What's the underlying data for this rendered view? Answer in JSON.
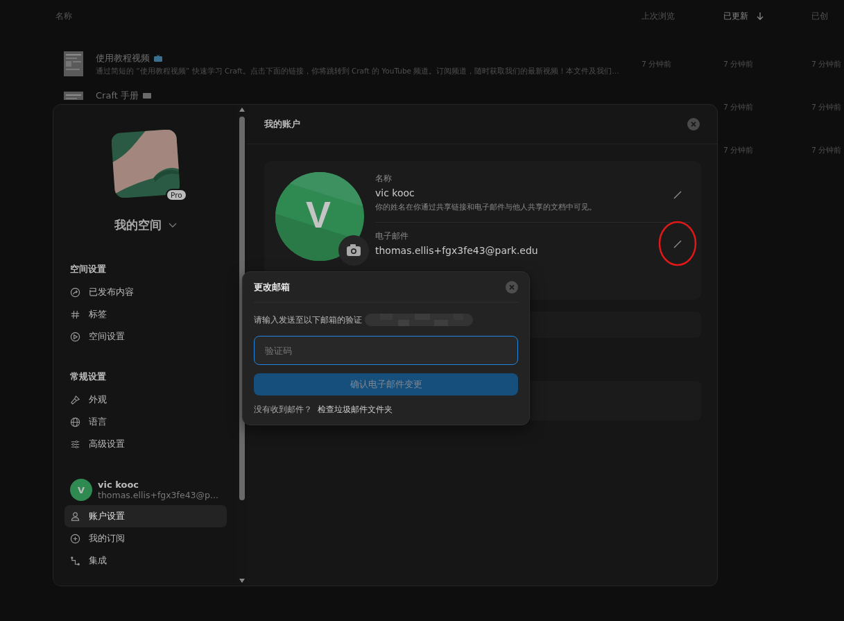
{
  "file_list": {
    "columns": [
      {
        "label": "名称",
        "sorted": false
      },
      {
        "label": "上次浏览",
        "sorted": false
      },
      {
        "label": "已更新",
        "sorted": true
      },
      {
        "label": "已创",
        "sorted": false
      }
    ],
    "rows": [
      {
        "title": "使用教程视频",
        "description": "通过简短的 “使用教程视频” 快速学习 Craft。点击下面的链接，你将跳转到 Craft 的 YouTube 频道。订阅频道，随时获取我们的最新视频！本文件及我们…",
        "last_viewed": "7 分钟前",
        "updated": "7 分钟前",
        "created": "7 分钟前"
      },
      {
        "title": "Craft 手册",
        "updated": "7 分钟前",
        "created": "7 分钟前"
      },
      {
        "updated": "7 分钟前",
        "created": "7 分钟前"
      }
    ]
  },
  "settings": {
    "workspace": {
      "name": "我的空间",
      "badge": "Pro"
    },
    "sections": [
      {
        "title": "空间设置",
        "items": [
          {
            "label": "已发布内容",
            "selected": false
          },
          {
            "label": "标签",
            "selected": false
          },
          {
            "label": "空间设置",
            "selected": false
          }
        ]
      },
      {
        "title": "常规设置",
        "items": [
          {
            "label": "外观",
            "selected": false
          },
          {
            "label": "语言",
            "selected": false
          },
          {
            "label": "高级设置",
            "selected": false
          }
        ]
      }
    ],
    "user": {
      "initial": "V",
      "name": "vic kooc",
      "email": "thomas.ellis+fgx3fe43@p..."
    },
    "account_items": [
      {
        "label": "账户设置",
        "selected": true
      },
      {
        "label": "我的订阅",
        "selected": false
      },
      {
        "label": "集成",
        "selected": false
      }
    ],
    "account": {
      "title": "我的账户",
      "avatar_initial": "V",
      "fields": [
        {
          "label": "名称",
          "value": "vic kooc",
          "hint": "你的姓名在你通过共享链接和电子邮件与他人共享的文档中可见。",
          "highlighted": false
        },
        {
          "label": "电子邮件",
          "value": "thomas.ellis+fgx3fe43@park.edu",
          "highlighted": true
        }
      ]
    },
    "dialog": {
      "title": "更改邮箱",
      "prompt": "请输入发送至以下邮箱的验证",
      "code_field": {
        "placeholder": "验证码",
        "focused": true
      },
      "confirm_button": {
        "label": "确认电子邮件变更",
        "disabled": true
      },
      "footer_text": "没有收到邮件？",
      "footer_link": "检查垃圾邮件文件夹"
    }
  }
}
